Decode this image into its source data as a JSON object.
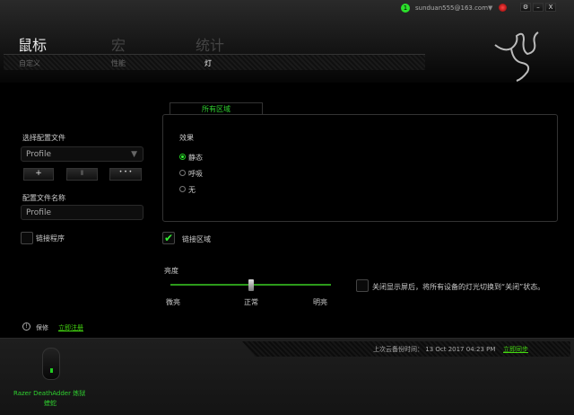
{
  "header": {
    "notification_count": "1",
    "user_email": "sunduan555@163.com",
    "window_buttons": [
      "⚙",
      "–",
      "X"
    ]
  },
  "main_tabs": [
    "鼠标",
    "宏",
    "统计"
  ],
  "sub_tabs": [
    "自定义",
    "性能",
    "灯"
  ],
  "left": {
    "select_profile_label": "选择配置文件",
    "profile_value": "Profile",
    "add_label": "+",
    "delete_label": "▮",
    "more_label": "• • •",
    "profile_name_label": "配置文件名称",
    "profile_name_value": "Profile",
    "link_program_label": "链接程序"
  },
  "lighting": {
    "zone_tab": "所有区域",
    "effect_label": "效果",
    "effects": [
      "静态",
      "呼吸",
      "无"
    ],
    "selected_effect": "静态",
    "link_zones_label": "链接区域",
    "link_zones_checked": true
  },
  "brightness": {
    "label": "亮度",
    "min_label": "微亮",
    "mid_label": "正常",
    "max_label": "明亮",
    "value_percent": 50
  },
  "display_off": {
    "label": "关闭显示屏后，将所有设备的灯光切换到“关闭”状态。",
    "checked": false
  },
  "warranty": {
    "label": "保修",
    "register_link": "立即注册"
  },
  "footer": {
    "backup_label": "上次云备份时间：",
    "backup_time": "13 Oct 2017 04:23 PM",
    "sync_link": "立即同步",
    "device_name": "Razer DeathAdder 炼狱",
    "device_name2": "蝰蛇"
  },
  "colors": {
    "accent": "#44d811"
  }
}
